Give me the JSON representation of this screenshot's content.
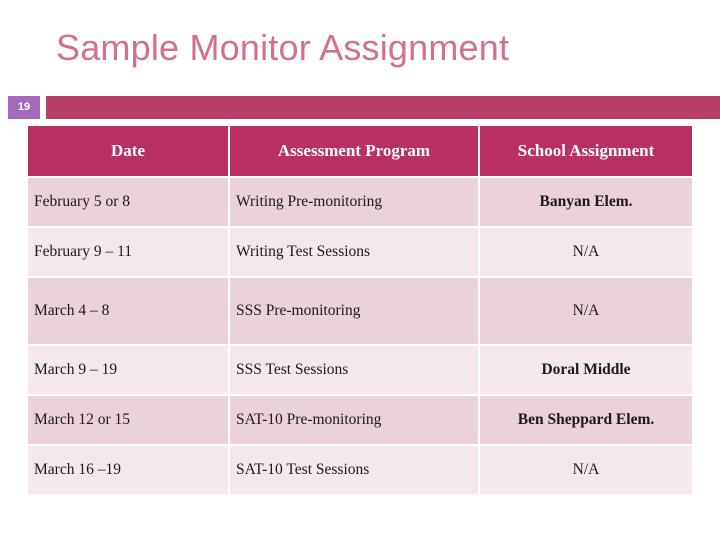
{
  "slide": {
    "title": "Sample Monitor Assignment",
    "number": "19",
    "accent_magenta": "#B83162",
    "accent_bar": "#B63E68",
    "accent_purple": "#A269BC",
    "title_color": "#D36F90",
    "row_dark": "#EBD1DA",
    "row_light": "#F5E8ED"
  },
  "table": {
    "headers": [
      "Date",
      "Assessment Program",
      "School Assignment"
    ],
    "rows": [
      {
        "date": "February 5 or 8",
        "program": "Writing Pre-monitoring",
        "school": "Banyan Elem.",
        "school_bold": true,
        "shade": "dark",
        "tall": false
      },
      {
        "date": "February 9 – 11",
        "program": "Writing Test Sessions",
        "school": "N/A",
        "school_bold": false,
        "shade": "light",
        "tall": false
      },
      {
        "date": "March 4 – 8",
        "program": "SSS Pre-monitoring",
        "school": "N/A",
        "school_bold": false,
        "shade": "dark",
        "tall": true
      },
      {
        "date": "March 9 – 19",
        "program": "SSS Test Sessions",
        "school": "Doral Middle",
        "school_bold": true,
        "shade": "light",
        "tall": false
      },
      {
        "date": "March 12 or 15",
        "program": "SAT-10 Pre-monitoring",
        "school": "Ben Sheppard Elem.",
        "school_bold": true,
        "shade": "dark",
        "tall": false
      },
      {
        "date": "March 16 –19",
        "program": "SAT-10 Test Sessions",
        "school": "N/A",
        "school_bold": false,
        "shade": "light",
        "tall": false
      }
    ]
  }
}
